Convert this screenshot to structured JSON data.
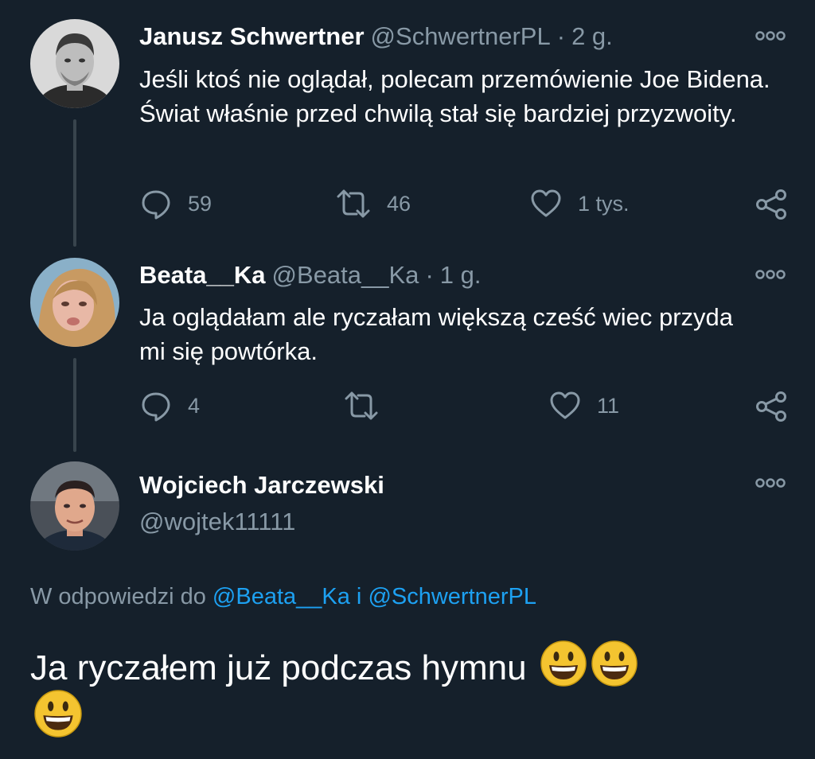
{
  "tweets": [
    {
      "name": "Janusz Schwertner",
      "handle": "@SchwertnerPL",
      "separator": "·",
      "time": "2 g.",
      "text": "Jeśli ktoś nie oglądał, polecam przemówienie Joe Bidena. Świat właśnie przed chwilą stał się bardziej przyzwoity.",
      "replies": "59",
      "retweets": "46",
      "likes": "1 tys."
    },
    {
      "name": "Beata__Ka",
      "handle": "@Beata__Ka",
      "separator": "·",
      "time": "1 g.",
      "text": "Ja oglądałam ale ryczałam większą cześć wiec przyda mi się powtórka.",
      "replies": "4",
      "retweets": "",
      "likes": "11"
    }
  ],
  "focused_tweet": {
    "name": "Wojciech Jarczewski",
    "handle": "@wojtek11111",
    "reply_prefix": "W odpowiedzi do",
    "reply_user_1": "@Beata__Ka",
    "reply_joiner": "i",
    "reply_user_2": "@SchwertnerPL",
    "text": "Ja ryczałem już podczas hymnu",
    "emoji": "grinning-face"
  },
  "icons": [
    "reply-icon",
    "retweet-icon",
    "like-icon",
    "share-icon",
    "more-icon"
  ],
  "colors": {
    "background": "#15202b",
    "secondary_text": "#8899a6",
    "link": "#1da1f2",
    "thread_line": "#38444d"
  }
}
